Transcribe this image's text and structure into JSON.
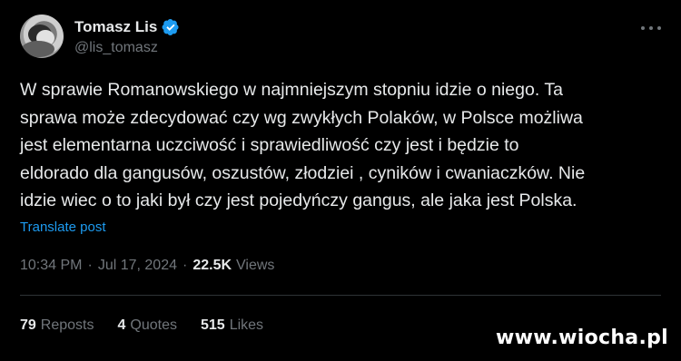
{
  "author": {
    "display_name": "Tomasz Lis",
    "handle": "@lis_tomasz",
    "verified": true
  },
  "tweet": {
    "text": "W sprawie Romanowskiego w najmniejszym stopniu idzie o niego. Ta\nsprawa może zdecydować czy wg zwykłych Polaków, w Polsce możliwa\njest elementarna uczciwość i sprawiedliwość czy jest i będzie to\neldorado dla gangusów, oszustów, złodziei , cyników i cwaniaczków. Nie\nidzie wiec o to jaki był czy jest pojedyńczy gangus, ale jaka jest Polska.",
    "translate_label": "Translate post",
    "time": "10:34 PM",
    "separator": "·",
    "date": "Jul 17, 2024",
    "views_count": "22.5K",
    "views_label": "Views"
  },
  "stats": {
    "reposts_count": "79",
    "reposts_label": "Reposts",
    "quotes_count": "4",
    "quotes_label": "Quotes",
    "likes_count": "515",
    "likes_label": "Likes"
  },
  "watermark": "www.wiocha.pl",
  "colors": {
    "background": "#000000",
    "text": "#e7e9ea",
    "secondary": "#71767b",
    "accent": "#1d9bf0",
    "divider": "#2f3336"
  },
  "icons": {
    "verified": "verified-badge-icon",
    "more": "more-options-icon"
  }
}
